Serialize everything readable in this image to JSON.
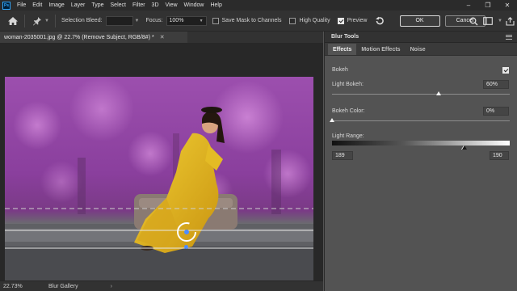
{
  "menubar": {
    "logo": "Ps",
    "items": [
      "File",
      "Edit",
      "Image",
      "Layer",
      "Type",
      "Select",
      "Filter",
      "3D",
      "View",
      "Window",
      "Help"
    ],
    "window_controls": [
      "minimize",
      "restore",
      "close"
    ]
  },
  "options": {
    "selection_bleed_label": "Selection Bleed:",
    "focus_label": "Focus:",
    "focus_value": "100%",
    "save_mask_label": "Save Mask to Channels",
    "save_mask_checked": false,
    "high_quality_label": "High Quality",
    "high_quality_checked": false,
    "preview_label": "Preview",
    "preview_checked": true,
    "ok_label": "OK",
    "cancel_label": "Cancel"
  },
  "document": {
    "tab_title": "woman-2035001.jpg @ 22.7% (Remove Subject, RGB/8#) *",
    "zoom": "22.73%",
    "status_text": "Blur Gallery"
  },
  "panel": {
    "title": "Blur Tools",
    "tabs": [
      "Effects",
      "Motion Effects",
      "Noise"
    ],
    "active_tab": "Effects",
    "bokeh_label": "Bokeh",
    "bokeh_checked": true,
    "light_bokeh_label": "Light Bokeh:",
    "light_bokeh_value": "60%",
    "light_bokeh_fraction": 0.6,
    "bokeh_color_label": "Bokeh Color:",
    "bokeh_color_value": "0%",
    "bokeh_color_fraction": 0.0,
    "light_range_label": "Light Range:",
    "light_range_low": "189",
    "light_range_high": "190",
    "light_range_low_fraction": 0.741,
    "light_range_high_fraction": 0.745
  },
  "colors": {
    "accent_blue": "#31a8ff",
    "bokeh_magenta": "#b54fc4",
    "dress_yellow": "#e1b51a"
  }
}
